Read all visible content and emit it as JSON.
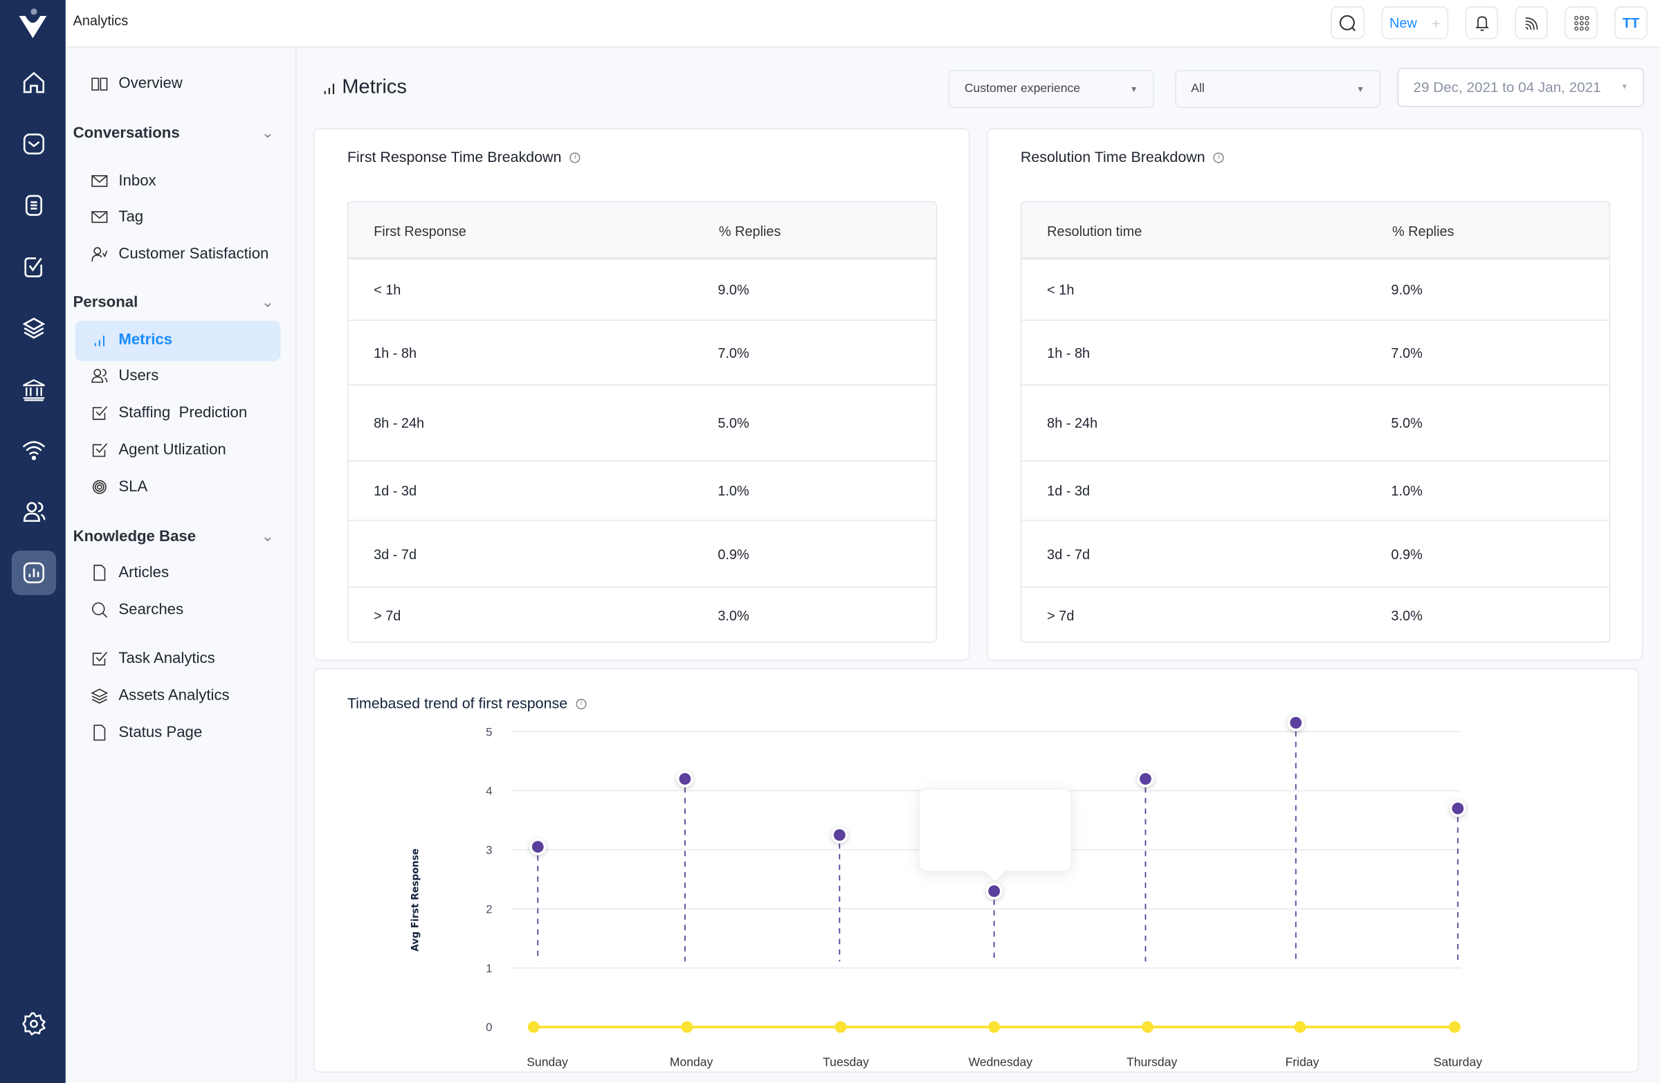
{
  "app": {
    "title": "Analytics",
    "brand_color": "#1b2f5a",
    "accent": "#1a8cff"
  },
  "rail": {
    "icons": [
      "logo-icon",
      "home-icon",
      "inbox-icon",
      "document-icon",
      "task-check-icon",
      "layers-icon",
      "bank-icon",
      "wifi-icon",
      "users-icon",
      "analytics-icon",
      "settings-icon"
    ],
    "active": "analytics-icon"
  },
  "topbar": {
    "new_label": "New",
    "avatar_initials": "TT",
    "buttons": [
      "search-icon",
      "plus-icon",
      "bell-icon",
      "signal-icon",
      "apps-grid-icon"
    ]
  },
  "nav": {
    "overview": "Overview",
    "sections": [
      {
        "title": "Conversations",
        "items": [
          "Inbox",
          "Tag",
          "Customer Satisfaction"
        ]
      },
      {
        "title": "Personal",
        "items": [
          "Metrics",
          "Users",
          "Staffing  Prediction",
          "Agent Utlization",
          "SLA"
        ]
      },
      {
        "title": "Knowledge Base",
        "items": [
          "Articles",
          "Searches"
        ]
      }
    ],
    "extra": [
      "Task Analytics",
      "Assets Analytics",
      "Status Page"
    ],
    "active": "Metrics"
  },
  "header": {
    "title": "Metrics",
    "filter1": "Customer experience",
    "filter2": "All",
    "date_range": "29 Dec, 2021 to 04 Jan, 2021"
  },
  "first_response": {
    "title": "First Response Time Breakdown",
    "columns": [
      "First Response",
      "% Replies"
    ],
    "rows": [
      [
        "< 1h",
        "9.0%"
      ],
      [
        "1h - 8h",
        "7.0%"
      ],
      [
        "8h - 24h",
        "5.0%"
      ],
      [
        "1d - 3d",
        "1.0%"
      ],
      [
        "3d - 7d",
        "0.9%"
      ],
      [
        "> 7d",
        "3.0%"
      ]
    ]
  },
  "resolution": {
    "title": "Resolution Time Breakdown",
    "columns": [
      "Resolution time",
      "% Replies"
    ],
    "rows": [
      [
        "< 1h",
        "9.0%"
      ],
      [
        "1h - 8h",
        "7.0%"
      ],
      [
        "8h - 24h",
        "5.0%"
      ],
      [
        "1d - 3d",
        "1.0%"
      ],
      [
        "3d - 7d",
        "0.9%"
      ],
      [
        "> 7d",
        "3.0%"
      ]
    ]
  },
  "chart_data": {
    "type": "scatter",
    "title": "Timebased trend of first response",
    "ylabel": "Avg First Response",
    "xlabel": "",
    "categories": [
      "Sunday",
      "Monday",
      "Tuesday",
      "Wednesday",
      "Thursday",
      "Friday",
      "Saturday"
    ],
    "yticks": [
      "0",
      "1",
      "2",
      "3",
      "4",
      "5"
    ],
    "ylim": [
      0,
      5
    ],
    "grid": true,
    "series": [
      {
        "values": [
          3.05,
          4.2,
          3.25,
          2.3,
          4.2,
          5.15,
          3.7
        ],
        "color": "#5a3f9c",
        "style": "lollipop-dashed"
      },
      {
        "values": [
          0,
          0,
          0,
          0,
          0,
          0,
          0
        ],
        "color": "#fbe233",
        "style": "line-markers"
      }
    ],
    "tooltip_at": "Wednesday"
  }
}
